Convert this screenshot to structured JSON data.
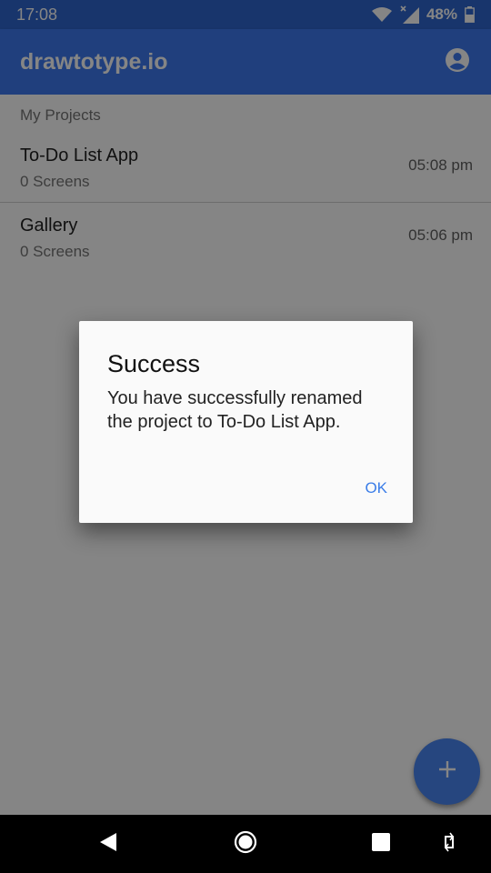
{
  "status_bar": {
    "time": "17:08",
    "battery": "48%",
    "icons": [
      "wifi-icon",
      "signal-icon",
      "battery-icon"
    ]
  },
  "app_bar": {
    "title": "drawtotype.io",
    "account_icon": "account-circle-icon"
  },
  "main": {
    "section_label": "My Projects",
    "projects": [
      {
        "name": "To-Do List App",
        "screens": "0 Screens",
        "time": "05:08 pm"
      },
      {
        "name": "Gallery",
        "screens": "0 Screens",
        "time": "05:06 pm"
      }
    ],
    "fab_icon": "plus-icon"
  },
  "dialog": {
    "title": "Success",
    "message": "You have successfully renamed the project to To-Do List App.",
    "ok_label": "OK"
  },
  "nav_bar": {
    "icons": [
      "back-icon",
      "home-icon",
      "recents-icon",
      "rotate-icon"
    ]
  },
  "colors": {
    "primary": "#3f7af0",
    "status_bar": "#2f67d0",
    "accent": "#4a86f3",
    "dialog_button": "#3b7de8"
  }
}
